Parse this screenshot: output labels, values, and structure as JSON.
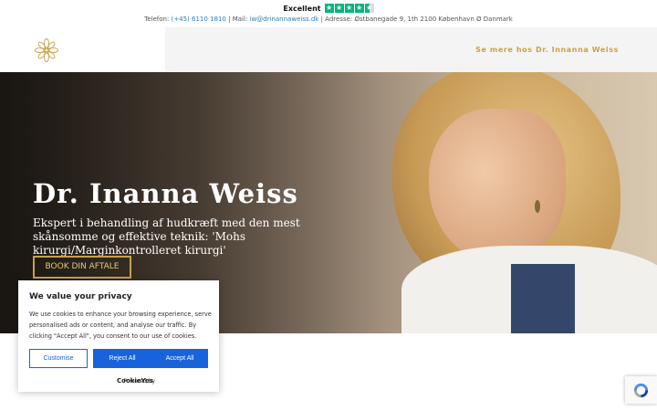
{
  "trustpilot": {
    "label": "Excellent",
    "stars": 4.5,
    "star_icon": "star-icon",
    "color": "#00b67a"
  },
  "contact": {
    "phone_label": "Telefon:",
    "phone": "(+45) 6110 1810",
    "sep1": "|",
    "mail_label": "Mail:",
    "mail": "iw@drinannaweiss.dk",
    "sep2": "|",
    "address": "Adresse: Østbanegade 9, 1th 2100 København Ø Danmark"
  },
  "header": {
    "logo_icon": "mandala-logo-icon",
    "nav_link": "Se mere hos Dr. Innanna Weiss",
    "accent": "#c8a24a"
  },
  "hero": {
    "title": "Dr. Inanna Weiss",
    "subtitle": "Ekspert i behandling af hudkræft med den mest skånsomme og effektive teknik: 'Mohs kirurgi/Marginkontrolleret kirurgi'",
    "cta": "BOOK DIN AFTALE"
  },
  "cookie": {
    "title": "We value your privacy",
    "text": "We use cookies to enhance your browsing experience, serve personalised ads or content, and analyse our traffic. By clicking \"Accept All\", you consent to our use of cookies.",
    "customise": "Customise",
    "reject": "Reject All",
    "accept": "Accept All",
    "powered_by": "Powered by",
    "brand": "CookieYes",
    "button_color": "#1863dc"
  },
  "recaptcha": {
    "icon": "recaptcha-icon"
  }
}
